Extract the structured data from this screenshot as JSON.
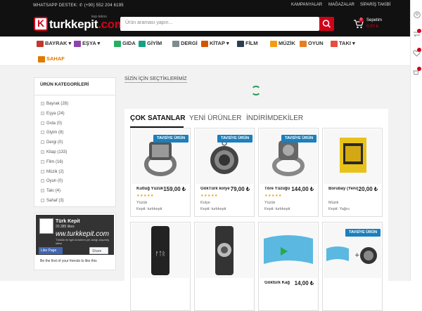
{
  "topbar": {
    "support": "WHATSAPP DESTEK: ✆ (+90) 552 204 6195",
    "links": [
      "KAMPANYALAR",
      "MAĞAZALAR",
      "SİPARİŞ TAKİBİ"
    ]
  },
  "logo": {
    "text": "turkkepit",
    "suffix": ".com",
    "tagline": "kep·tekno"
  },
  "search": {
    "placeholder": "Ürün araması yapın..."
  },
  "cart": {
    "label": "Sepetim",
    "amount": "0,00 ₺",
    "count": "0"
  },
  "nav": {
    "items": [
      {
        "label": "BAYRAK ▾",
        "icon": "flag-icon",
        "color": "#c0392b"
      },
      {
        "label": "EŞYA ▾",
        "icon": "box-icon",
        "color": "#8e44ad"
      },
      {
        "label": "GIDA",
        "icon": "food-icon",
        "color": "#27ae60"
      },
      {
        "label": "GİYİM",
        "icon": "shirt-icon",
        "color": "#16a085"
      },
      {
        "label": "DERGİ",
        "icon": "magazine-icon",
        "color": "#7f8c8d"
      },
      {
        "label": "KİTAP ▾",
        "icon": "book-icon",
        "color": "#d35400"
      },
      {
        "label": "FİLM",
        "icon": "film-icon",
        "color": "#2c3e50"
      },
      {
        "label": "MÜZİK",
        "icon": "music-icon",
        "color": "#f39c12"
      },
      {
        "label": "OYUN",
        "icon": "game-icon",
        "color": "#e67e22"
      },
      {
        "label": "TAKI ▾",
        "icon": "gem-icon",
        "color": "#e74c3c"
      },
      {
        "label": "SAHAF",
        "icon": "bookstore-icon",
        "color": "#e07a00"
      }
    ]
  },
  "sidebar": {
    "title": "ÜRÜN KATEGORİLERİ",
    "categories": [
      {
        "label": "Bayrak (28)",
        "expand": "+"
      },
      {
        "label": "Eşya (24)",
        "expand": "+"
      },
      {
        "label": "Gıda (0)",
        "expand": ""
      },
      {
        "label": "Giyim (8)",
        "expand": ""
      },
      {
        "label": "Dergi (0)",
        "expand": ""
      },
      {
        "label": "Kitap (133)",
        "expand": "+"
      },
      {
        "label": "Film (16)",
        "expand": ""
      },
      {
        "label": "Müzik (2)",
        "expand": ""
      },
      {
        "label": "Oyun (0)",
        "expand": ""
      },
      {
        "label": "Takı (4)",
        "expand": "+"
      },
      {
        "label": "Sahaf (3)",
        "expand": ""
      }
    ]
  },
  "facebook": {
    "name": "Türk Kepit",
    "likes": "20.385 likes",
    "big": "ww.turkkepit.com",
    "small": "Türklük ile ilgili ürünlerin yer aldığı alışveriş sitesi",
    "like_label": "Like Page",
    "share_label": "Share",
    "friends": "Be the first of your friends to like this"
  },
  "picked_title": "SİZİN İÇİN SEÇTİKLERİMİZ",
  "tabs": [
    "ÇOK SATANLAR",
    "YENİ ÜRÜNLER",
    "İNDİRİMDEKİLER"
  ],
  "products": [
    {
      "name": "Kutluğ Yüzük",
      "price": "159,00 ₺",
      "category": "Yüzük",
      "seller": "Kepit: turkkepit",
      "badge": "TAVSİYE ÜRÜN",
      "stars": "★★★★★"
    },
    {
      "name": "GökTürk kolye",
      "price": "79,00 ₺",
      "category": "Kolye",
      "seller": "Kepit: turkkepit",
      "badge": "TAVSİYE ÜRÜN",
      "stars": "★★★★★"
    },
    {
      "name": "Töre Yüzüğü",
      "price": "144,00 ₺",
      "category": "Yüzük",
      "seller": "Kepit: turkkepit",
      "badge": "TAVSİYE ÜRÜN",
      "stars": "★★★★★"
    },
    {
      "name": "Borubay (Yeni)",
      "price": "20,00 ₺",
      "category": "Müzik",
      "seller": "Kepit: Yağru",
      "badge": "",
      "stars": ""
    },
    {
      "name": "",
      "price": "",
      "category": "",
      "seller": "",
      "badge": "",
      "stars": ""
    },
    {
      "name": "",
      "price": "",
      "category": "",
      "seller": "",
      "badge": "",
      "stars": ""
    },
    {
      "name": "Göktürk Kağ",
      "price": "14,00 ₺",
      "category": "",
      "seller": "",
      "badge": "",
      "stars": ""
    },
    {
      "name": "",
      "price": "",
      "category": "",
      "seller": "",
      "badge": "TAVSİYE ÜRÜN",
      "stars": ""
    }
  ]
}
